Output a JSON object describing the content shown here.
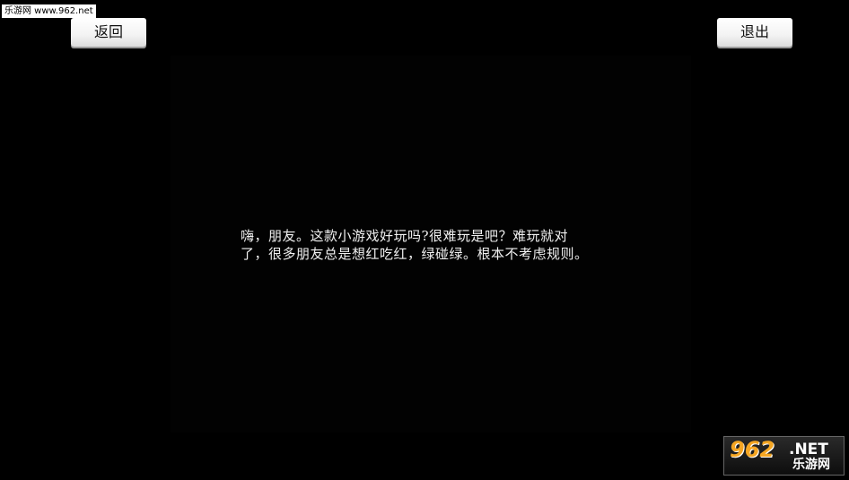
{
  "watermark": {
    "text": "乐游网 www.962.net"
  },
  "buttons": {
    "back_label": "返回",
    "exit_label": "退出"
  },
  "dialog": {
    "line1": "嗨，朋友。这款小游戏好玩吗?很难玩是吧？难玩就对",
    "line2": "了，很多朋友总是想红吃红，绿碰绿。根本不考虑规则。"
  },
  "logo": {
    "number": "962",
    "suffix": ".NET",
    "chinese": "乐游网"
  },
  "colors": {
    "background": "#000000",
    "text": "#f0f0f0",
    "button": "#f3f3f3",
    "logo_accent": "#f5a623"
  }
}
